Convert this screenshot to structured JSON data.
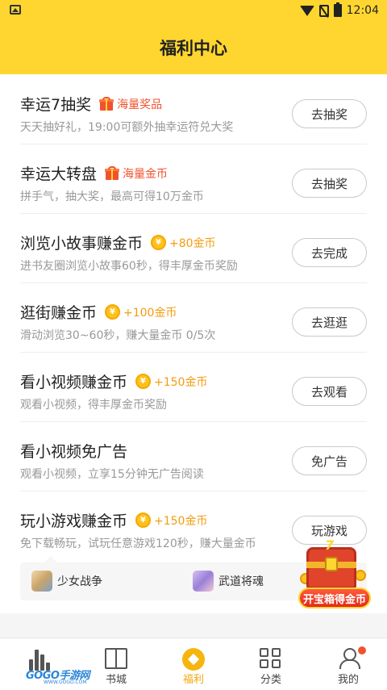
{
  "status_bar": {
    "time": "12:04"
  },
  "header": {
    "title": "福利中心"
  },
  "tasks": [
    {
      "name": "幸运7抽奖",
      "tag": "海量奖品",
      "tag_icon": "gift-icon",
      "desc": "天天抽好礼，19:00可额外抽幸运符兑大奖",
      "button": "去抽奖"
    },
    {
      "name": "幸运大转盘",
      "tag": "海量金币",
      "tag_icon": "gift-icon",
      "desc": "拼手气，抽大奖，最高可得10万金币",
      "button": "去抽奖"
    },
    {
      "name": "浏览小故事赚金币",
      "tag": "+80金币",
      "tag_icon": "coin-icon",
      "desc": "进书友圈浏览小故事60秒，得丰厚金币奖励",
      "button": "去完成"
    },
    {
      "name": "逛街赚金币",
      "tag": "+100金币",
      "tag_icon": "coin-icon",
      "desc": "滑动浏览30~60秒，赚大量金币 0/5次",
      "button": "去逛逛"
    },
    {
      "name": "看小视频赚金币",
      "tag": "+150金币",
      "tag_icon": "coin-icon",
      "desc": "观看小视频，得丰厚金币奖励",
      "button": "去观看"
    },
    {
      "name": "看小视频免广告",
      "tag": "",
      "tag_icon": "",
      "desc": "观看小视频，立享15分钟无广告阅读",
      "button": "免广告"
    },
    {
      "name": "玩小游戏赚金币",
      "tag": "+150金币",
      "tag_icon": "coin-icon",
      "desc": "免下载畅玩，试玩任意游戏120秒，赚大量金币",
      "button": "玩游戏"
    }
  ],
  "coin_symbol": "¥",
  "games": [
    {
      "name": "少女战争"
    },
    {
      "name": "武道将魂"
    }
  ],
  "treasure": {
    "label": "开宝箱得金币",
    "mark": "7"
  },
  "tabs": [
    {
      "label": "书城",
      "icon": "book-icon",
      "active": false
    },
    {
      "label": "福利",
      "icon": "welfare-icon",
      "active": true
    },
    {
      "label": "分类",
      "icon": "grid-icon",
      "active": false
    },
    {
      "label": "我的",
      "icon": "user-icon",
      "active": false
    }
  ],
  "watermark": {
    "text": "GOGO手游网",
    "sub": "WWW.GOGO.COM"
  },
  "colors": {
    "brand_yellow": "#ffd630",
    "tag_red": "#f0522f",
    "tag_gold": "#f39c10",
    "active_tab": "#f2a70c"
  }
}
